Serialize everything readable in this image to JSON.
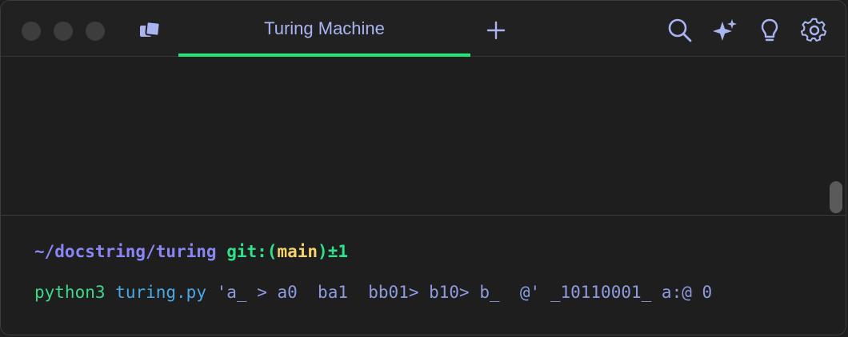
{
  "window": {
    "traffic_lights": [
      "close",
      "minimize",
      "zoom"
    ]
  },
  "tabbar": {
    "active_tab": {
      "label": "Turing Machine"
    },
    "new_tab_symbol": "+",
    "tools": [
      {
        "icon": "search-icon"
      },
      {
        "icon": "ai-sparkle-icon"
      },
      {
        "icon": "lightbulb-icon"
      },
      {
        "icon": "gear-icon"
      }
    ],
    "accent_color": "#1ee87a"
  },
  "terminal": {
    "prompt": {
      "path": "~/docstring/turing",
      "git_prefix": "git:(",
      "branch": "main",
      "git_suffix": ")",
      "dirty": "±1"
    },
    "command": {
      "program": "python3",
      "file": "turing.py",
      "args": "'a_ > a0  ba1  bb01> b10> b_  @' _10110001_ a:@ 0"
    }
  }
}
